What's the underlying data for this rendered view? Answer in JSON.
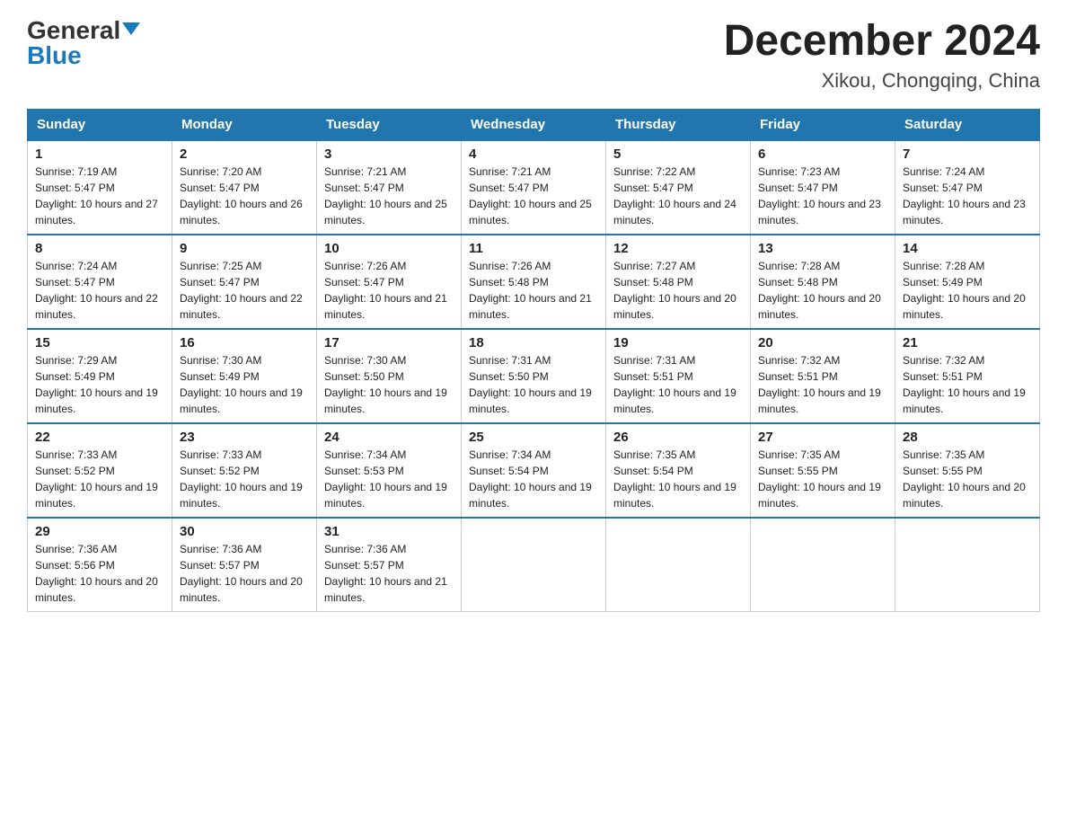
{
  "header": {
    "logo_general": "General",
    "logo_blue": "Blue",
    "month_title": "December 2024",
    "location": "Xikou, Chongqing, China"
  },
  "days_of_week": [
    "Sunday",
    "Monday",
    "Tuesday",
    "Wednesday",
    "Thursday",
    "Friday",
    "Saturday"
  ],
  "weeks": [
    [
      {
        "day": "1",
        "sunrise": "7:19 AM",
        "sunset": "5:47 PM",
        "daylight": "10 hours and 27 minutes."
      },
      {
        "day": "2",
        "sunrise": "7:20 AM",
        "sunset": "5:47 PM",
        "daylight": "10 hours and 26 minutes."
      },
      {
        "day": "3",
        "sunrise": "7:21 AM",
        "sunset": "5:47 PM",
        "daylight": "10 hours and 25 minutes."
      },
      {
        "day": "4",
        "sunrise": "7:21 AM",
        "sunset": "5:47 PM",
        "daylight": "10 hours and 25 minutes."
      },
      {
        "day": "5",
        "sunrise": "7:22 AM",
        "sunset": "5:47 PM",
        "daylight": "10 hours and 24 minutes."
      },
      {
        "day": "6",
        "sunrise": "7:23 AM",
        "sunset": "5:47 PM",
        "daylight": "10 hours and 23 minutes."
      },
      {
        "day": "7",
        "sunrise": "7:24 AM",
        "sunset": "5:47 PM",
        "daylight": "10 hours and 23 minutes."
      }
    ],
    [
      {
        "day": "8",
        "sunrise": "7:24 AM",
        "sunset": "5:47 PM",
        "daylight": "10 hours and 22 minutes."
      },
      {
        "day": "9",
        "sunrise": "7:25 AM",
        "sunset": "5:47 PM",
        "daylight": "10 hours and 22 minutes."
      },
      {
        "day": "10",
        "sunrise": "7:26 AM",
        "sunset": "5:47 PM",
        "daylight": "10 hours and 21 minutes."
      },
      {
        "day": "11",
        "sunrise": "7:26 AM",
        "sunset": "5:48 PM",
        "daylight": "10 hours and 21 minutes."
      },
      {
        "day": "12",
        "sunrise": "7:27 AM",
        "sunset": "5:48 PM",
        "daylight": "10 hours and 20 minutes."
      },
      {
        "day": "13",
        "sunrise": "7:28 AM",
        "sunset": "5:48 PM",
        "daylight": "10 hours and 20 minutes."
      },
      {
        "day": "14",
        "sunrise": "7:28 AM",
        "sunset": "5:49 PM",
        "daylight": "10 hours and 20 minutes."
      }
    ],
    [
      {
        "day": "15",
        "sunrise": "7:29 AM",
        "sunset": "5:49 PM",
        "daylight": "10 hours and 19 minutes."
      },
      {
        "day": "16",
        "sunrise": "7:30 AM",
        "sunset": "5:49 PM",
        "daylight": "10 hours and 19 minutes."
      },
      {
        "day": "17",
        "sunrise": "7:30 AM",
        "sunset": "5:50 PM",
        "daylight": "10 hours and 19 minutes."
      },
      {
        "day": "18",
        "sunrise": "7:31 AM",
        "sunset": "5:50 PM",
        "daylight": "10 hours and 19 minutes."
      },
      {
        "day": "19",
        "sunrise": "7:31 AM",
        "sunset": "5:51 PM",
        "daylight": "10 hours and 19 minutes."
      },
      {
        "day": "20",
        "sunrise": "7:32 AM",
        "sunset": "5:51 PM",
        "daylight": "10 hours and 19 minutes."
      },
      {
        "day": "21",
        "sunrise": "7:32 AM",
        "sunset": "5:51 PM",
        "daylight": "10 hours and 19 minutes."
      }
    ],
    [
      {
        "day": "22",
        "sunrise": "7:33 AM",
        "sunset": "5:52 PM",
        "daylight": "10 hours and 19 minutes."
      },
      {
        "day": "23",
        "sunrise": "7:33 AM",
        "sunset": "5:52 PM",
        "daylight": "10 hours and 19 minutes."
      },
      {
        "day": "24",
        "sunrise": "7:34 AM",
        "sunset": "5:53 PM",
        "daylight": "10 hours and 19 minutes."
      },
      {
        "day": "25",
        "sunrise": "7:34 AM",
        "sunset": "5:54 PM",
        "daylight": "10 hours and 19 minutes."
      },
      {
        "day": "26",
        "sunrise": "7:35 AM",
        "sunset": "5:54 PM",
        "daylight": "10 hours and 19 minutes."
      },
      {
        "day": "27",
        "sunrise": "7:35 AM",
        "sunset": "5:55 PM",
        "daylight": "10 hours and 19 minutes."
      },
      {
        "day": "28",
        "sunrise": "7:35 AM",
        "sunset": "5:55 PM",
        "daylight": "10 hours and 20 minutes."
      }
    ],
    [
      {
        "day": "29",
        "sunrise": "7:36 AM",
        "sunset": "5:56 PM",
        "daylight": "10 hours and 20 minutes."
      },
      {
        "day": "30",
        "sunrise": "7:36 AM",
        "sunset": "5:57 PM",
        "daylight": "10 hours and 20 minutes."
      },
      {
        "day": "31",
        "sunrise": "7:36 AM",
        "sunset": "5:57 PM",
        "daylight": "10 hours and 21 minutes."
      },
      null,
      null,
      null,
      null
    ]
  ]
}
